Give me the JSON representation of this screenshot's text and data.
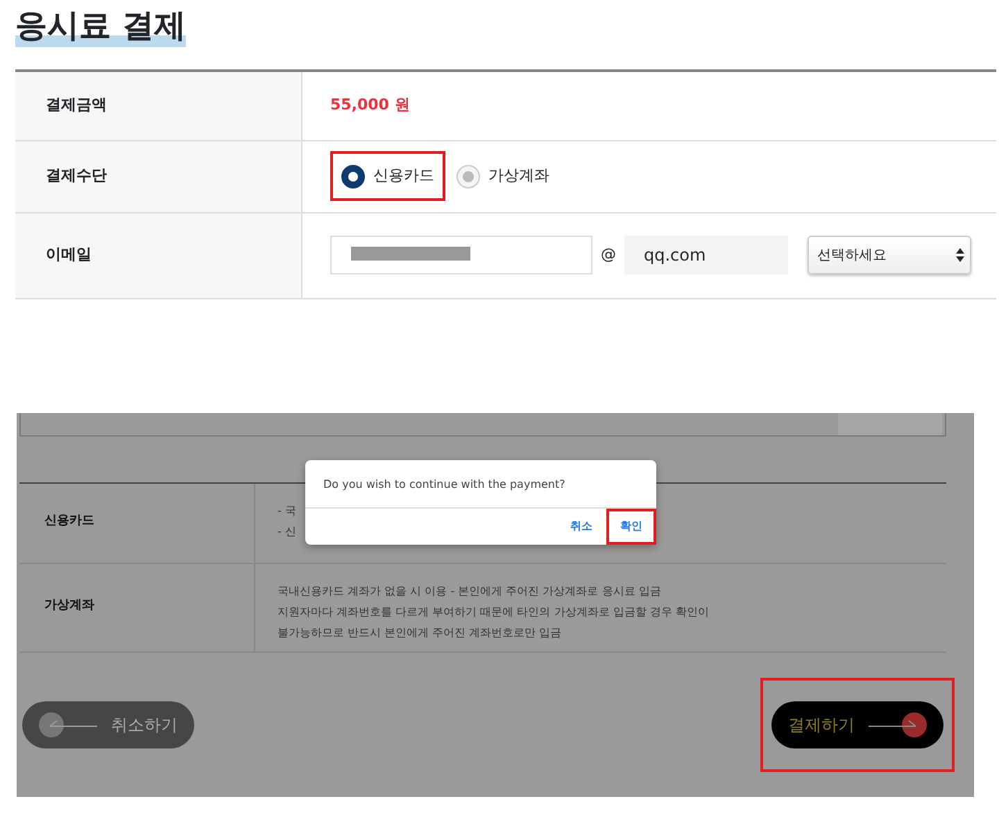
{
  "title": "응시료 결제",
  "form": {
    "rows": [
      {
        "kind": "amount",
        "label": "결제금액",
        "value": "55,000 원"
      },
      {
        "kind": "radio",
        "label": "결제수단",
        "options": [
          {
            "label": "신용카드",
            "selected": true,
            "highlighted": true
          },
          {
            "label": "가상계좌",
            "selected": false,
            "highlighted": false
          }
        ]
      },
      {
        "kind": "email",
        "label": "이메일",
        "at": "@",
        "domain": "qq.com",
        "select": "선택하세요"
      }
    ]
  },
  "background_page": {
    "rows": [
      {
        "label": "신용카드",
        "lines": [
          "-  국",
          "-  신"
        ]
      },
      {
        "label": "가상계좌",
        "lines": [
          "국내신용카드 계좌가 없을 시 이용 - 본인에게 주어진 가상계좌로 응시료 입금",
          "지원자마다 계좌번호를 다르게 부여하기 때문에 타인의 가상계좌로 입금할 경우 확인이",
          "불가능하므로 반드시 본인에게 주어진 계좌번호로만 입금"
        ]
      }
    ],
    "buttons": [
      {
        "kind": "back",
        "label": "취소하기",
        "highlighted": false
      },
      {
        "kind": "forward",
        "label": "결제하기",
        "highlighted": true
      }
    ]
  },
  "dialog": {
    "message": "Do you wish to continue with the payment?",
    "buttons": [
      {
        "label": "취소",
        "highlighted": false
      },
      {
        "label": "확인",
        "highlighted": true
      }
    ]
  }
}
